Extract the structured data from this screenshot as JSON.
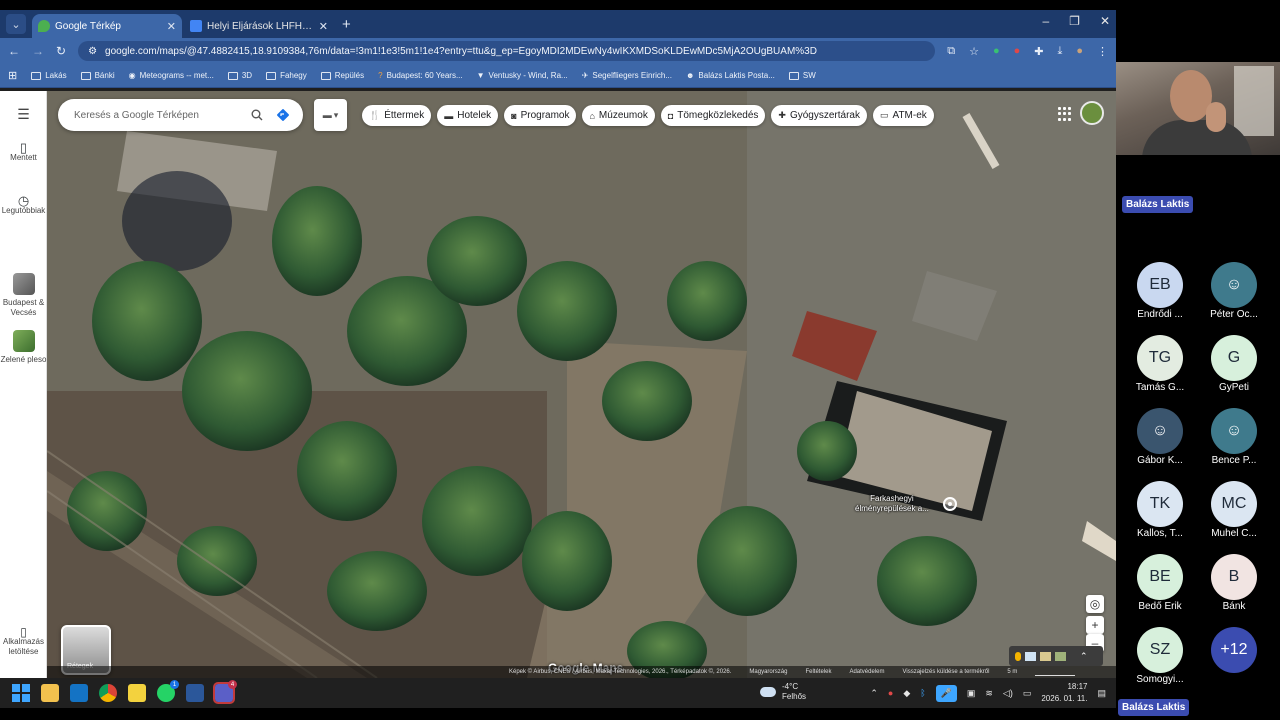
{
  "browser": {
    "tabs": [
      {
        "title": "Google Térkép",
        "active": true
      },
      {
        "title": "Helyi Eljárások LHFH 2025 - Go",
        "active": false
      }
    ],
    "url": "google.com/maps/@47.4882415,18.9109384,76m/data=!3m1!1e3!5m1!1e4?entry=ttu&g_ep=EgoyMDI2MDEwNy4wIKXMDSoKLDEwMDc5MjA2OUgBUAM%3D",
    "bookmarks": [
      "Lakás",
      "Bánki",
      "Meteograms -- met...",
      "3D",
      "Fahegy",
      "Repülés",
      "Budapest: 60 Years...",
      "Ventusky - Wind, Ra...",
      "Segelfliegers Einrich...",
      "Balázs Laktis Posta...",
      "SW"
    ]
  },
  "sidebar": {
    "items": [
      {
        "label": "Mentett",
        "icon": "bookmark-icon"
      },
      {
        "label": "Legutóbbiak",
        "icon": "history-icon"
      },
      {
        "label": "Budapest & Vecsés",
        "icon": "thumbnail"
      },
      {
        "label": "Zelené pleso",
        "icon": "thumbnail"
      },
      {
        "label": "Alkalmazás letöltése",
        "icon": "phone-icon"
      }
    ]
  },
  "map": {
    "search_placeholder": "Keresés a Google Térképen",
    "chips": [
      {
        "label": "Éttermek",
        "icon": "restaurant-icon"
      },
      {
        "label": "Hotelek",
        "icon": "hotel-icon"
      },
      {
        "label": "Programok",
        "icon": "camera-icon"
      },
      {
        "label": "Múzeumok",
        "icon": "museum-icon"
      },
      {
        "label": "Tömegközlekedés",
        "icon": "transit-icon"
      },
      {
        "label": "Gyógyszertárak",
        "icon": "pharmacy-icon"
      },
      {
        "label": "ATM-ek",
        "icon": "atm-icon"
      }
    ],
    "place_label_line1": "Farkashegyi",
    "place_label_line2": "élményrepülések a...",
    "layers_label": "Rétegek",
    "watermark": "Google Maps",
    "attribution": "Képek © Airbus, CNES / Airbus, Maxar Technologies, 2026., Térképadatok ©, 2026.",
    "footer_links": [
      "Magyarország",
      "Feltételek",
      "Adatvédelem",
      "Visszajelzés küldése a termékről"
    ],
    "scale": "5 m"
  },
  "taskbar": {
    "weather_temp": "-4°C",
    "weather_desc": "Felhős",
    "time": "18:17",
    "date": "2026. 01. 11.",
    "whatsapp_badge": "1",
    "teams_badge": "4"
  },
  "meeting": {
    "speaker": "Balázs Laktis",
    "participants": [
      {
        "initials": "EB",
        "name": "Endrődi ...",
        "color": "#c9d8f0"
      },
      {
        "initials": "",
        "name": "Péter Oc...",
        "color": "#3f7a8c"
      },
      {
        "initials": "TG",
        "name": "Tamás G...",
        "color": "#e3ece1"
      },
      {
        "initials": "G",
        "name": "GyPeti",
        "color": "#d7f0dc"
      },
      {
        "initials": "",
        "name": "Gábor K...",
        "color": "#3a556e"
      },
      {
        "initials": "",
        "name": "Bence P...",
        "color": "#3f7a8c"
      },
      {
        "initials": "TK",
        "name": "Kallos, T...",
        "color": "#dbe6f2"
      },
      {
        "initials": "MC",
        "name": "Muhel C...",
        "color": "#dbe6f2"
      },
      {
        "initials": "BE",
        "name": "Bedő Erik",
        "color": "#d7f0dc"
      },
      {
        "initials": "B",
        "name": "Bánk",
        "color": "#f1e4e2"
      },
      {
        "initials": "SZ",
        "name": "Somogyi...",
        "color": "#d7f0dc"
      },
      {
        "initials": "+12",
        "name": "",
        "color": "#3b4cb0"
      }
    ],
    "self_label": "Balázs Laktis"
  }
}
